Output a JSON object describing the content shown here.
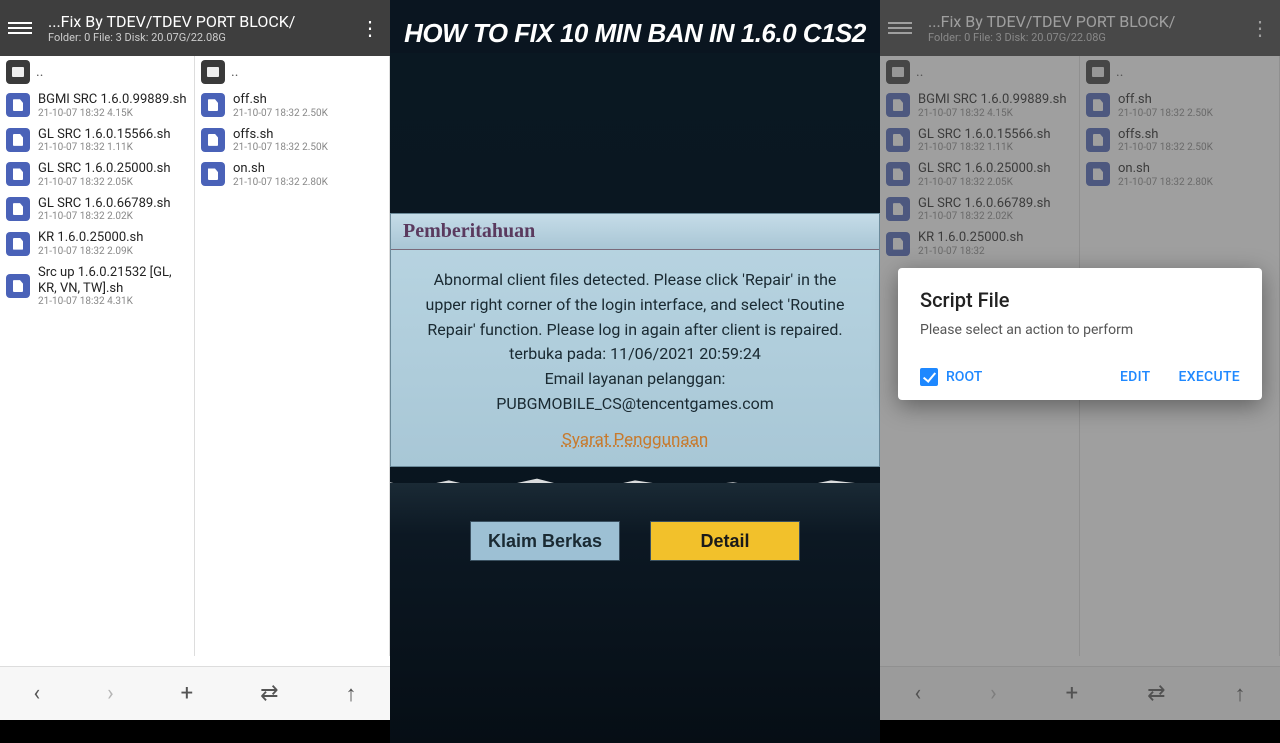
{
  "center_heading": "HOW TO FIX 10 MIN BAN IN 1.6.0 C1S2",
  "fm_left": {
    "title": "...Fix By TDEV/TDEV PORT BLOCK/",
    "subtitle": "Folder: 0  File: 3  Disk: 20.07G/22.08G",
    "col1": [
      {
        "name": "BGMI SRC 1.6.0.99889.sh",
        "meta": "21-10-07 18:32  4.15K"
      },
      {
        "name": "GL SRC 1.6.0.15566.sh",
        "meta": "21-10-07 18:32  1.11K"
      },
      {
        "name": "GL SRC 1.6.0.25000.sh",
        "meta": "21-10-07 18:32  2.05K"
      },
      {
        "name": "GL SRC 1.6.0.66789.sh",
        "meta": "21-10-07 18:32  2.02K"
      },
      {
        "name": "KR 1.6.0.25000.sh",
        "meta": "21-10-07 18:32  2.09K"
      },
      {
        "name": "Src up 1.6.0.21532 [GL, KR, VN, TW].sh",
        "meta": "21-10-07 18:32  4.31K"
      }
    ],
    "col2": [
      {
        "name": "off.sh",
        "meta": "21-10-07 18:32  2.50K"
      },
      {
        "name": "offs.sh",
        "meta": "21-10-07 18:32  2.50K"
      },
      {
        "name": "on.sh",
        "meta": "21-10-07 18:32  2.80K"
      }
    ]
  },
  "fm_right": {
    "title": "...Fix By TDEV/TDEV PORT BLOCK/",
    "subtitle": "Folder: 0  File: 3  Disk: 20.07G/22.08G",
    "col1": [
      {
        "name": "BGMI SRC 1.6.0.99889.sh",
        "meta": "21-10-07 18:32  4.15K"
      },
      {
        "name": "GL SRC 1.6.0.15566.sh",
        "meta": "21-10-07 18:32  1.11K"
      },
      {
        "name": "GL SRC 1.6.0.25000.sh",
        "meta": "21-10-07 18:32  2.05K"
      },
      {
        "name": "GL SRC 1.6.0.66789.sh",
        "meta": "21-10-07 18:32  2.02K"
      },
      {
        "name": "KR 1.6.0.25000.sh",
        "meta": "21-10-07 18:32"
      }
    ],
    "col2": [
      {
        "name": "off.sh",
        "meta": "21-10-07 18:32  2.50K"
      },
      {
        "name": "offs.sh",
        "meta": "21-10-07 18:32  2.50K"
      },
      {
        "name": "on.sh",
        "meta": "21-10-07 18:32  2.80K"
      }
    ]
  },
  "notice": {
    "heading": "Pemberitahuan",
    "line1": "Abnormal client files detected. Please click 'Repair' in the upper right corner of the login interface, and select 'Routine Repair' function. Please log in again after client is repaired.",
    "line2": "terbuka pada: 11/06/2021 20:59:24",
    "line3": "Email layanan pelanggan: PUBGMOBILE_CS@tencentgames.com",
    "link": "Syarat Penggunaan",
    "btn1": "Klaim Berkas",
    "btn2": "Detail"
  },
  "dialog": {
    "title": "Script File",
    "msg": "Please select an action to perform",
    "root": "ROOT",
    "edit": "EDIT",
    "execute": "EXECUTE"
  },
  "up_label": ".."
}
